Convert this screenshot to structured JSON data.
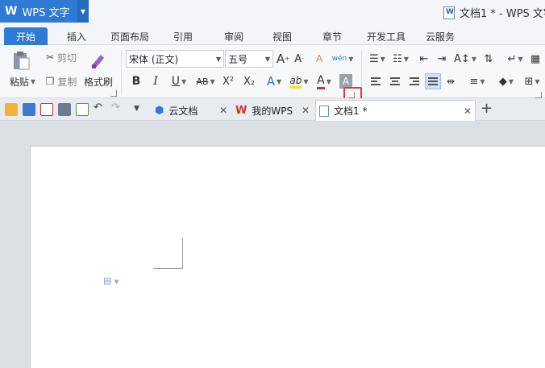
{
  "app": {
    "logo": "W",
    "name": "WPS 文字",
    "window_title": "文档1 * - WPS 文字"
  },
  "menu": {
    "tabs": [
      {
        "label": "开始",
        "active": true
      },
      {
        "label": "插入"
      },
      {
        "label": "页面布局"
      },
      {
        "label": "引用"
      },
      {
        "label": "审阅"
      },
      {
        "label": "视图"
      },
      {
        "label": "章节"
      },
      {
        "label": "开发工具"
      },
      {
        "label": "云服务"
      }
    ]
  },
  "ribbon": {
    "clipboard": {
      "paste": "粘贴",
      "cut": "剪切",
      "copy": "复制",
      "format_painter": "格式刷"
    },
    "font": {
      "family": "宋体 (正文)",
      "size": "五号"
    },
    "icons": {
      "grow_font": "A",
      "shrink_font": "A",
      "clear_format": "A",
      "pinyin": "wén",
      "bold": "B",
      "italic": "I",
      "underline": "U",
      "strike": "AB",
      "superscript": "X²",
      "subscript": "X₂",
      "text_effect": "A",
      "highlight": "ab",
      "font_color": "A",
      "char_shading": "A"
    }
  },
  "doc_tabs": [
    {
      "label": "云文档"
    },
    {
      "label": "我的WPS"
    },
    {
      "label": "文档1 *",
      "active": true
    }
  ],
  "colors": {
    "accent": "#2e7ad4",
    "highlight_red": "#e53935",
    "wps_red": "#d32f2f"
  }
}
